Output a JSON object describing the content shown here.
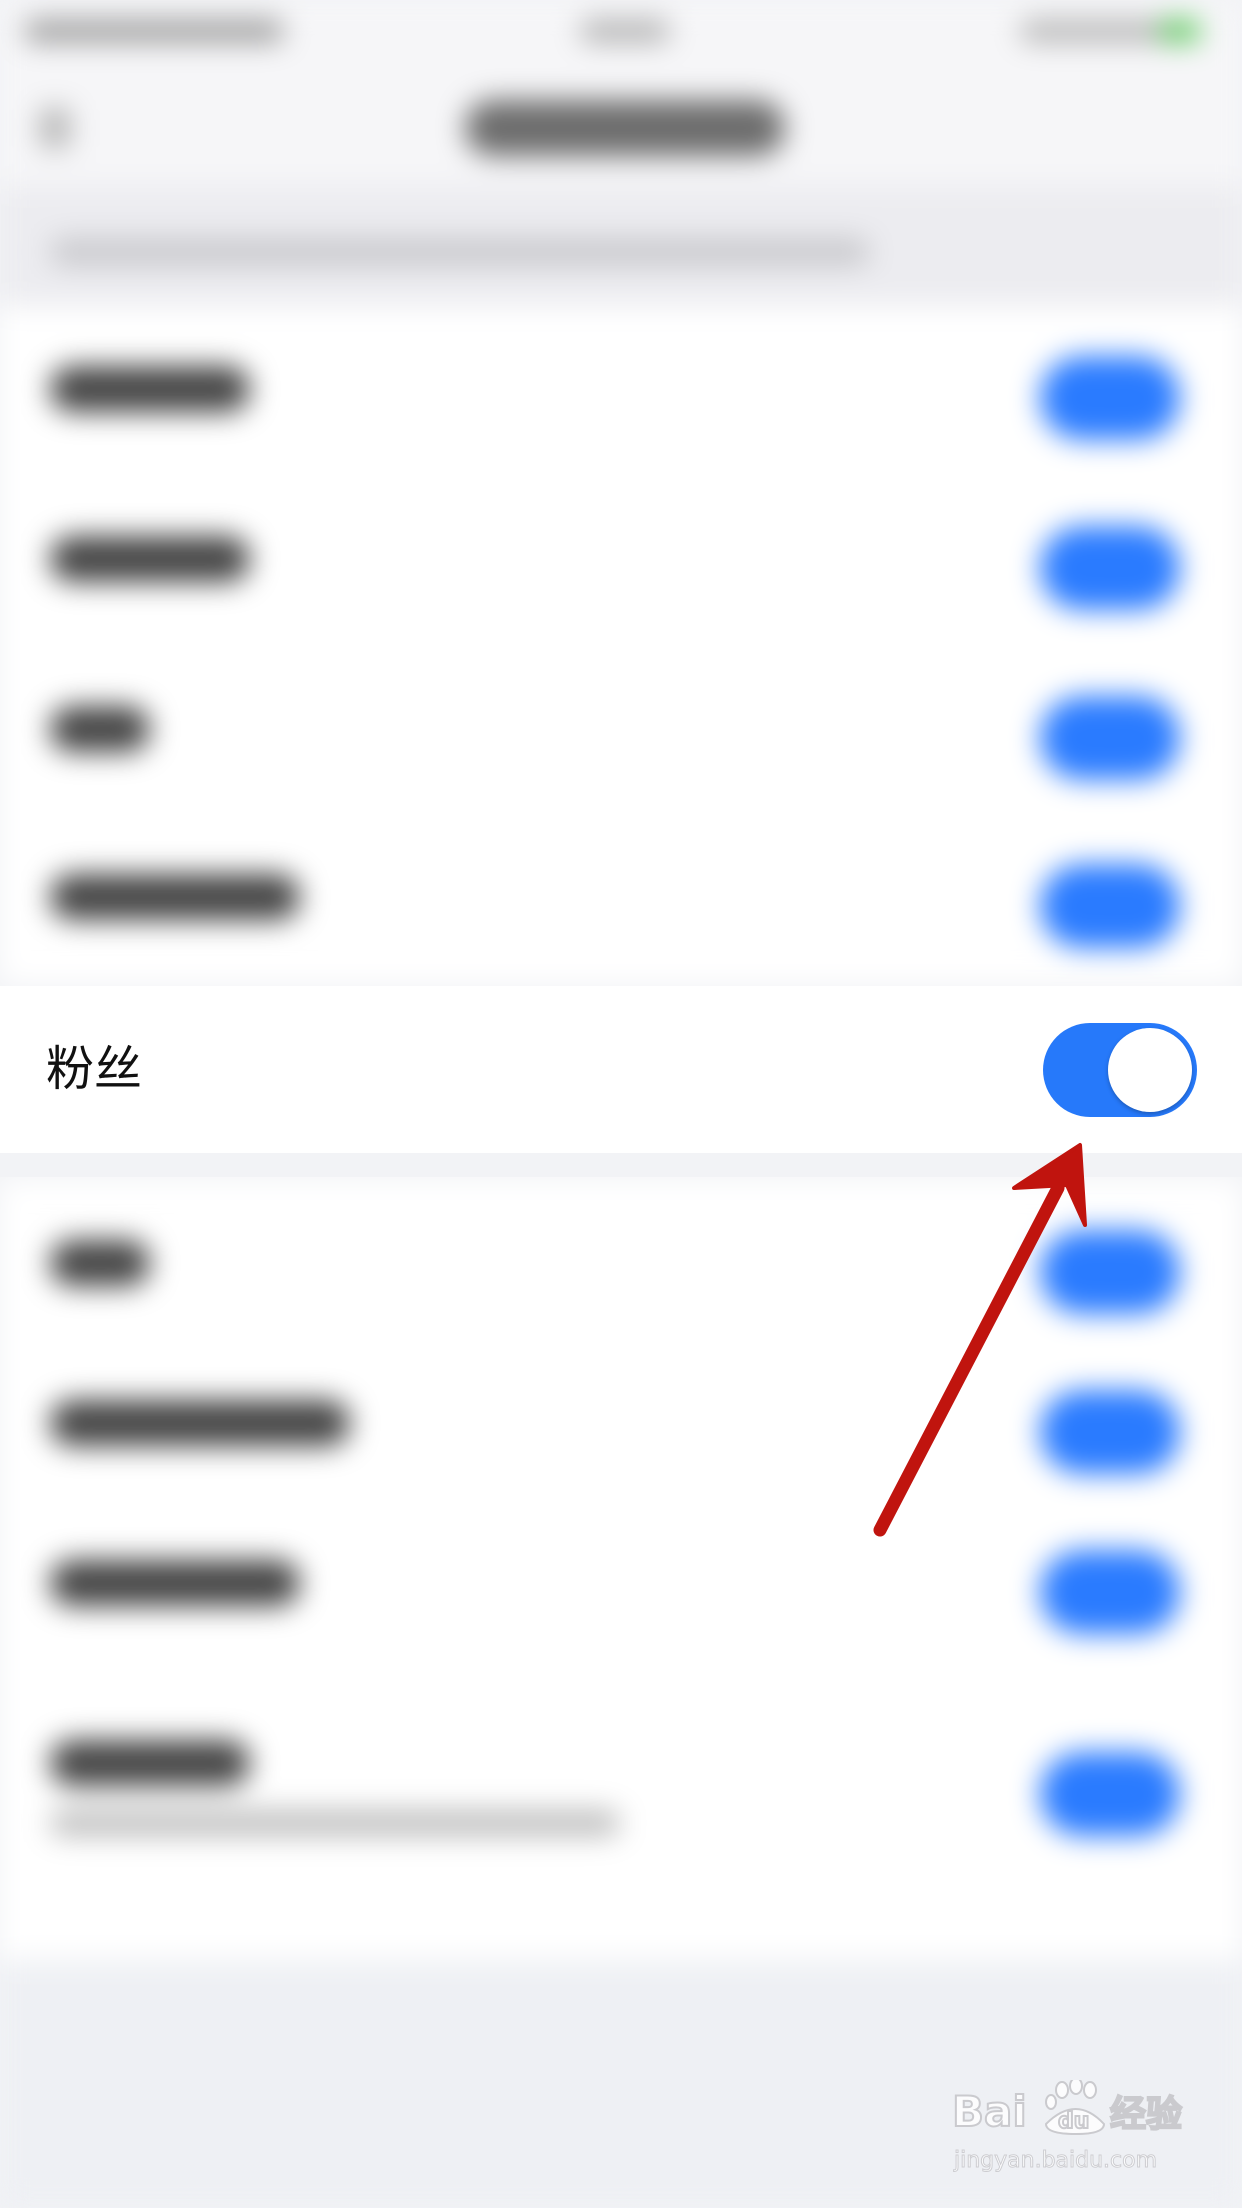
{
  "highlighted_setting": {
    "label": "粉丝",
    "toggle_on": true
  },
  "colors": {
    "accent_blue": "#2679fa",
    "annotation_red": "#c0140e",
    "background": "#f2f3f6"
  },
  "annotation": {
    "type": "arrow",
    "points_to": "fans-toggle"
  },
  "watermark": {
    "logo_text": "Baidu经验",
    "url": "jingyan.baidu.com"
  }
}
